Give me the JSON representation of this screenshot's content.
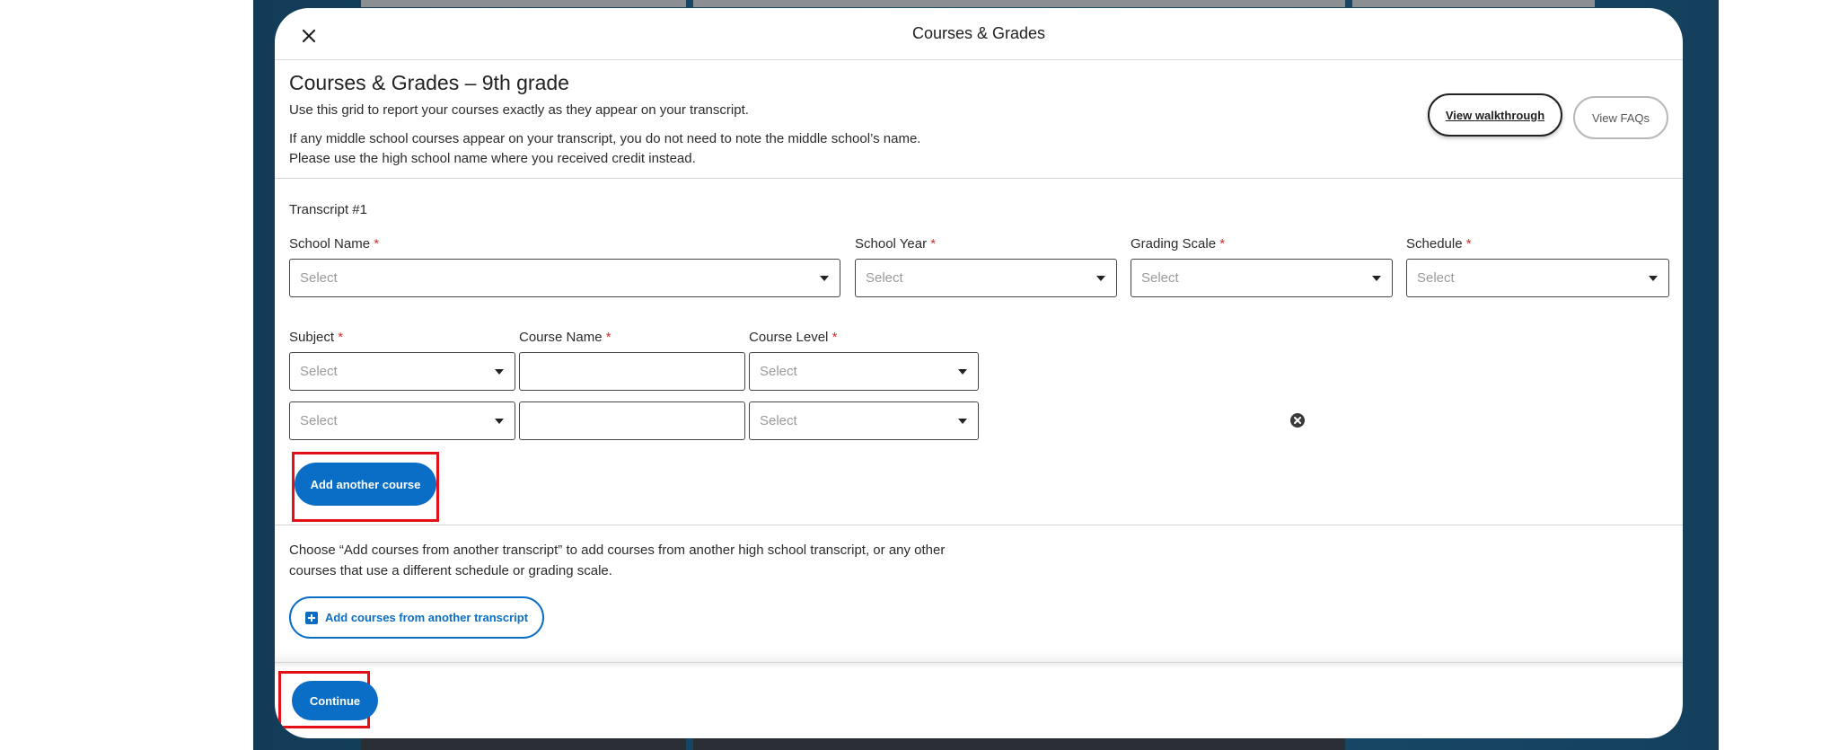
{
  "modal": {
    "title": "Courses & Grades",
    "heading": "Courses & Grades – 9th grade",
    "intro_line1": "Use this grid to report your courses exactly as they appear on your transcript.",
    "intro_line2": "If any middle school courses appear on your transcript, you do not need to note the middle school’s name.",
    "intro_line3": "Please use the high school name where you received credit instead.",
    "walkthrough_button": "View walkthrough",
    "faqs_button": "View FAQs"
  },
  "transcript": {
    "label": "Transcript #1",
    "fields": {
      "school_name": {
        "label": "School Name",
        "value": "Select"
      },
      "school_year": {
        "label": "School Year",
        "value": "Select"
      },
      "grading_scale": {
        "label": "Grading Scale",
        "value": "Select"
      },
      "schedule": {
        "label": "Schedule",
        "value": "Select"
      }
    },
    "required_mark": "*",
    "course_columns": {
      "subject": "Subject",
      "course_name": "Course Name",
      "course_level": "Course Level"
    },
    "course_rows": [
      {
        "subject": "Select",
        "course_name": "",
        "course_level": "Select"
      },
      {
        "subject": "Select",
        "course_name": "",
        "course_level": "Select"
      }
    ],
    "add_course_button": "Add another course"
  },
  "other_transcript": {
    "text_line1": "Choose “Add courses from another transcript” to add courses from another high school transcript, or any other",
    "text_line2": "courses that use a different schedule or grading scale.",
    "button": "Add courses from another transcript"
  },
  "footer": {
    "continue_button": "Continue"
  },
  "colors": {
    "primary": "#0a6ec6",
    "required": "#d32f2f",
    "highlight": "#e3101a"
  }
}
